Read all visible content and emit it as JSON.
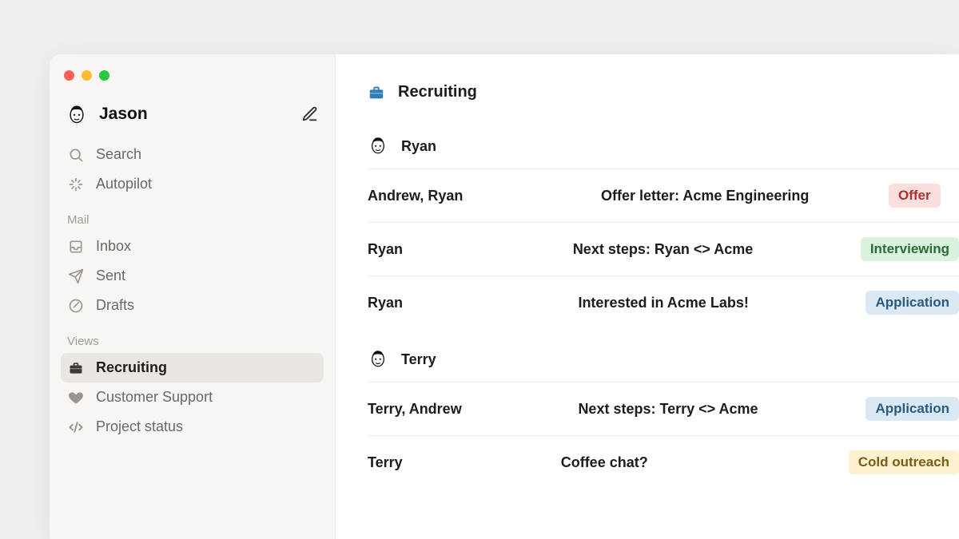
{
  "account": {
    "name": "Jason"
  },
  "sidebar": {
    "search_label": "Search",
    "autopilot_label": "Autopilot",
    "sections": {
      "mail": {
        "label": "Mail",
        "items": [
          {
            "label": "Inbox"
          },
          {
            "label": "Sent"
          },
          {
            "label": "Drafts"
          }
        ]
      },
      "views": {
        "label": "Views",
        "items": [
          {
            "label": "Recruiting"
          },
          {
            "label": "Customer Support"
          },
          {
            "label": "Project status"
          }
        ]
      }
    }
  },
  "main": {
    "view_title": "Recruiting",
    "groups": [
      {
        "name": "Ryan",
        "rows": [
          {
            "from": "Andrew, Ryan",
            "subject": "Offer letter: Acme Engineering",
            "tag_label": "Offer",
            "tag_kind": "offer"
          },
          {
            "from": "Ryan",
            "subject": "Next steps: Ryan <> Acme",
            "tag_label": "Interviewing",
            "tag_kind": "interviewing"
          },
          {
            "from": "Ryan",
            "subject": "Interested in Acme Labs!",
            "tag_label": "Application",
            "tag_kind": "application"
          }
        ]
      },
      {
        "name": "Terry",
        "rows": [
          {
            "from": "Terry, Andrew",
            "subject": "Next steps: Terry <> Acme",
            "tag_label": "Application",
            "tag_kind": "application"
          },
          {
            "from": "Terry",
            "subject": "Coffee chat?",
            "tag_label": "Cold outreach",
            "tag_kind": "cold"
          }
        ]
      }
    ]
  }
}
